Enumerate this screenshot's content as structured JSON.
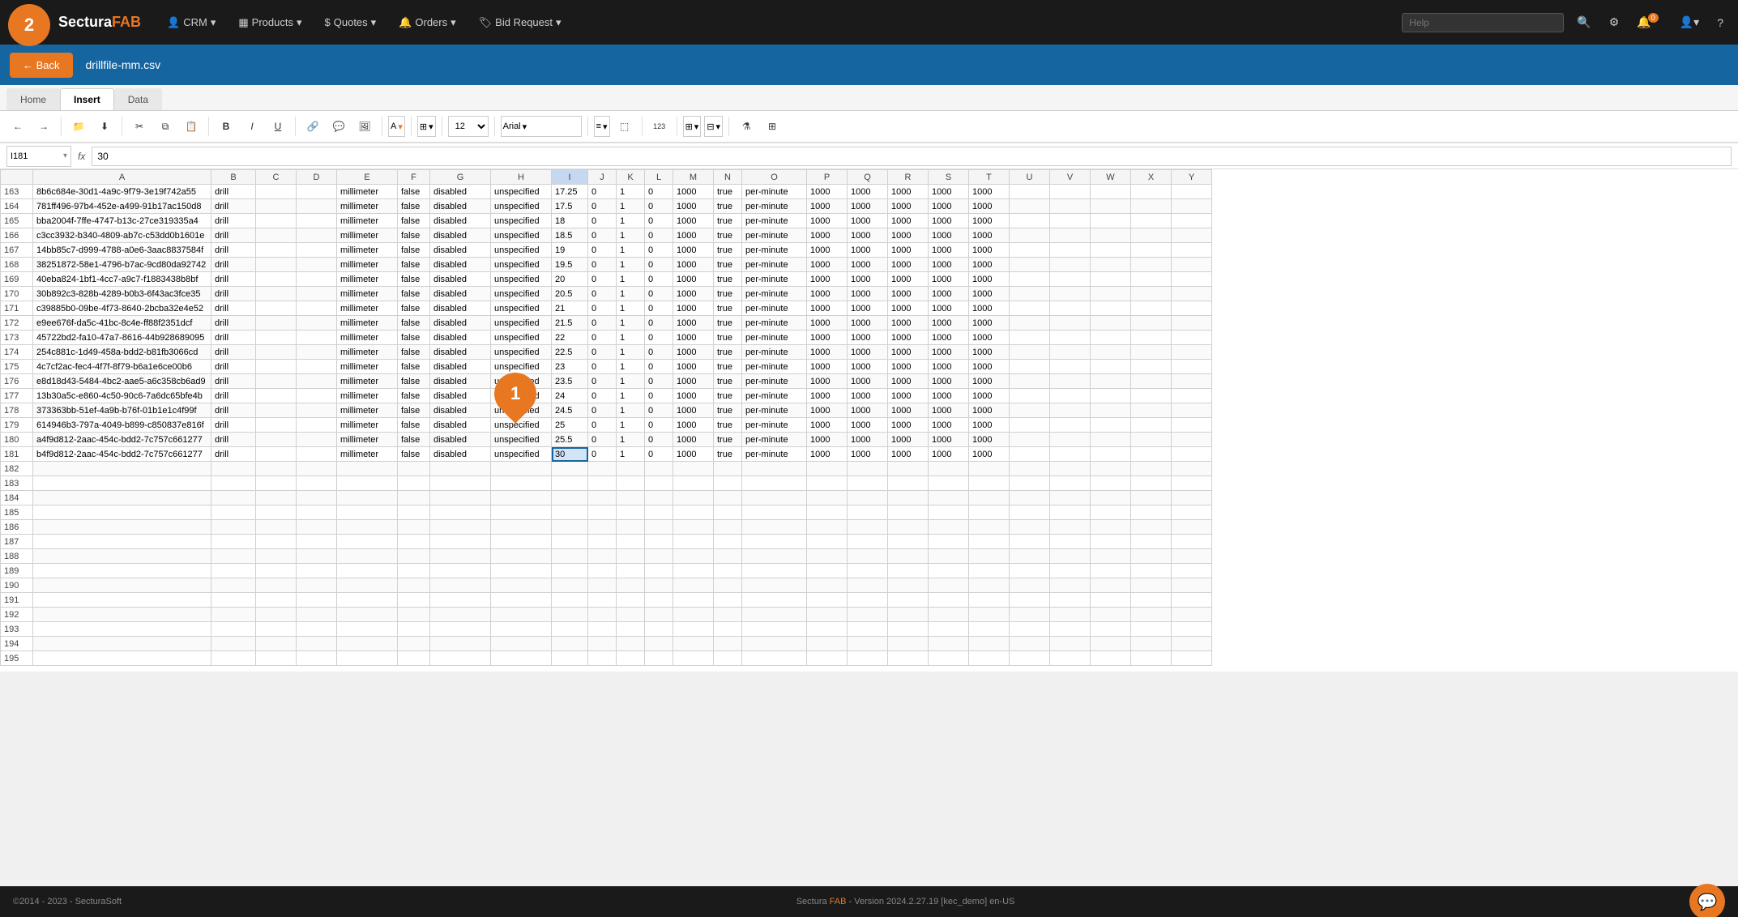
{
  "app": {
    "brand_sectura": "Sectura",
    "brand_fab": "FAB",
    "badge_count": "0"
  },
  "navbar": {
    "crm_label": "CRM",
    "products_label": "Products",
    "quotes_label": "Quotes",
    "orders_label": "Orders",
    "bid_request_label": "Bid Request",
    "help_placeholder": "Help"
  },
  "breadcrumb": {
    "back_label": "← Back",
    "file_name": "drillfile-mm.csv"
  },
  "tabs": {
    "home_label": "Home",
    "insert_label": "Insert",
    "data_label": "Data"
  },
  "formula_bar": {
    "cell_ref": "I181",
    "formula_symbol": "fx",
    "value": "30"
  },
  "columns": [
    "",
    "A",
    "B",
    "C",
    "D",
    "E",
    "F",
    "G",
    "H",
    "I",
    "J",
    "K",
    "L",
    "M",
    "N",
    "O",
    "P",
    "Q",
    "R",
    "S",
    "T",
    "U",
    "V",
    "W",
    "X",
    "Y"
  ],
  "rows": [
    {
      "num": 163,
      "A": "8b6c684e-30d1-4a9c-9f79-3e19f742a55",
      "B": "drill",
      "C": "",
      "D": "",
      "E": "millimeter",
      "F": "false",
      "G": "disabled",
      "H": "unspecified",
      "I": "17.25",
      "J": "0",
      "K": "1",
      "L": "0",
      "M": "1000",
      "N": "true",
      "O": "per-minute",
      "P": "1000",
      "Q": "1000",
      "R": "1000",
      "S": "1000",
      "T": "1000",
      "U": "",
      "V": "",
      "W": "",
      "X": "",
      "Y": ""
    },
    {
      "num": 164,
      "A": "781ff496-97b4-452e-a499-91b17ac150d8",
      "B": "drill",
      "C": "",
      "D": "",
      "E": "millimeter",
      "F": "false",
      "G": "disabled",
      "H": "unspecified",
      "I": "17.5",
      "J": "0",
      "K": "1",
      "L": "0",
      "M": "1000",
      "N": "true",
      "O": "per-minute",
      "P": "1000",
      "Q": "1000",
      "R": "1000",
      "S": "1000",
      "T": "1000",
      "U": "",
      "V": "",
      "W": "",
      "X": "",
      "Y": ""
    },
    {
      "num": 165,
      "A": "bba2004f-7ffe-4747-b13c-27ce319335a4",
      "B": "drill",
      "C": "",
      "D": "",
      "E": "millimeter",
      "F": "false",
      "G": "disabled",
      "H": "unspecified",
      "I": "18",
      "J": "0",
      "K": "1",
      "L": "0",
      "M": "1000",
      "N": "true",
      "O": "per-minute",
      "P": "1000",
      "Q": "1000",
      "R": "1000",
      "S": "1000",
      "T": "1000",
      "U": "",
      "V": "",
      "W": "",
      "X": "",
      "Y": ""
    },
    {
      "num": 166,
      "A": "c3cc3932-b340-4809-ab7c-c53dd0b1601e",
      "B": "drill",
      "C": "",
      "D": "",
      "E": "millimeter",
      "F": "false",
      "G": "disabled",
      "H": "unspecified",
      "I": "18.5",
      "J": "0",
      "K": "1",
      "L": "0",
      "M": "1000",
      "N": "true",
      "O": "per-minute",
      "P": "1000",
      "Q": "1000",
      "R": "1000",
      "S": "1000",
      "T": "1000",
      "U": "",
      "V": "",
      "W": "",
      "X": "",
      "Y": ""
    },
    {
      "num": 167,
      "A": "14bb85c7-d999-4788-a0e6-3aac8837584f",
      "B": "drill",
      "C": "",
      "D": "",
      "E": "millimeter",
      "F": "false",
      "G": "disabled",
      "H": "unspecified",
      "I": "19",
      "J": "0",
      "K": "1",
      "L": "0",
      "M": "1000",
      "N": "true",
      "O": "per-minute",
      "P": "1000",
      "Q": "1000",
      "R": "1000",
      "S": "1000",
      "T": "1000",
      "U": "",
      "V": "",
      "W": "",
      "X": "",
      "Y": ""
    },
    {
      "num": 168,
      "A": "38251872-58e1-4796-b7ac-9cd80da92742",
      "B": "drill",
      "C": "",
      "D": "",
      "E": "millimeter",
      "F": "false",
      "G": "disabled",
      "H": "unspecified",
      "I": "19.5",
      "J": "0",
      "K": "1",
      "L": "0",
      "M": "1000",
      "N": "true",
      "O": "per-minute",
      "P": "1000",
      "Q": "1000",
      "R": "1000",
      "S": "1000",
      "T": "1000",
      "U": "",
      "V": "",
      "W": "",
      "X": "",
      "Y": ""
    },
    {
      "num": 169,
      "A": "40eba824-1bf1-4cc7-a9c7-f1883438b8bf",
      "B": "drill",
      "C": "",
      "D": "",
      "E": "millimeter",
      "F": "false",
      "G": "disabled",
      "H": "unspecified",
      "I": "20",
      "J": "0",
      "K": "1",
      "L": "0",
      "M": "1000",
      "N": "true",
      "O": "per-minute",
      "P": "1000",
      "Q": "1000",
      "R": "1000",
      "S": "1000",
      "T": "1000",
      "U": "",
      "V": "",
      "W": "",
      "X": "",
      "Y": ""
    },
    {
      "num": 170,
      "A": "30b892c3-828b-4289-b0b3-6f43ac3fce35",
      "B": "drill",
      "C": "",
      "D": "",
      "E": "millimeter",
      "F": "false",
      "G": "disabled",
      "H": "unspecified",
      "I": "20.5",
      "J": "0",
      "K": "1",
      "L": "0",
      "M": "1000",
      "N": "true",
      "O": "per-minute",
      "P": "1000",
      "Q": "1000",
      "R": "1000",
      "S": "1000",
      "T": "1000",
      "U": "",
      "V": "",
      "W": "",
      "X": "",
      "Y": ""
    },
    {
      "num": 171,
      "A": "c39885b0-09be-4f73-8640-2bcba32e4e52",
      "B": "drill",
      "C": "",
      "D": "",
      "E": "millimeter",
      "F": "false",
      "G": "disabled",
      "H": "unspecified",
      "I": "21",
      "J": "0",
      "K": "1",
      "L": "0",
      "M": "1000",
      "N": "true",
      "O": "per-minute",
      "P": "1000",
      "Q": "1000",
      "R": "1000",
      "S": "1000",
      "T": "1000",
      "U": "",
      "V": "",
      "W": "",
      "X": "",
      "Y": ""
    },
    {
      "num": 172,
      "A": "e9ee676f-da5c-41bc-8c4e-ff88f2351dcf",
      "B": "drill",
      "C": "",
      "D": "",
      "E": "millimeter",
      "F": "false",
      "G": "disabled",
      "H": "unspecified",
      "I": "21.5",
      "J": "0",
      "K": "1",
      "L": "0",
      "M": "1000",
      "N": "true",
      "O": "per-minute",
      "P": "1000",
      "Q": "1000",
      "R": "1000",
      "S": "1000",
      "T": "1000",
      "U": "",
      "V": "",
      "W": "",
      "X": "",
      "Y": ""
    },
    {
      "num": 173,
      "A": "45722bd2-fa10-47a7-8616-44b928689095",
      "B": "drill",
      "C": "",
      "D": "",
      "E": "millimeter",
      "F": "false",
      "G": "disabled",
      "H": "unspecified",
      "I": "22",
      "J": "0",
      "K": "1",
      "L": "0",
      "M": "1000",
      "N": "true",
      "O": "per-minute",
      "P": "1000",
      "Q": "1000",
      "R": "1000",
      "S": "1000",
      "T": "1000",
      "U": "",
      "V": "",
      "W": "",
      "X": "",
      "Y": ""
    },
    {
      "num": 174,
      "A": "254c881c-1d49-458a-bdd2-b81fb3066cd",
      "B": "drill",
      "C": "",
      "D": "",
      "E": "millimeter",
      "F": "false",
      "G": "disabled",
      "H": "unspecified",
      "I": "22.5",
      "J": "0",
      "K": "1",
      "L": "0",
      "M": "1000",
      "N": "true",
      "O": "per-minute",
      "P": "1000",
      "Q": "1000",
      "R": "1000",
      "S": "1000",
      "T": "1000",
      "U": "",
      "V": "",
      "W": "",
      "X": "",
      "Y": ""
    },
    {
      "num": 175,
      "A": "4c7cf2ac-fec4-4f7f-8f79-b6a1e6ce00b6",
      "B": "drill",
      "C": "",
      "D": "",
      "E": "millimeter",
      "F": "false",
      "G": "disabled",
      "H": "unspecified",
      "I": "23",
      "J": "0",
      "K": "1",
      "L": "0",
      "M": "1000",
      "N": "true",
      "O": "per-minute",
      "P": "1000",
      "Q": "1000",
      "R": "1000",
      "S": "1000",
      "T": "1000",
      "U": "",
      "V": "",
      "W": "",
      "X": "",
      "Y": ""
    },
    {
      "num": 176,
      "A": "e8d18d43-5484-4bc2-aae5-a6c358cb6ad9",
      "B": "drill",
      "C": "",
      "D": "",
      "E": "millimeter",
      "F": "false",
      "G": "disabled",
      "H": "unspecified",
      "I": "23.5",
      "J": "0",
      "K": "1",
      "L": "0",
      "M": "1000",
      "N": "true",
      "O": "per-minute",
      "P": "1000",
      "Q": "1000",
      "R": "1000",
      "S": "1000",
      "T": "1000",
      "U": "",
      "V": "",
      "W": "",
      "X": "",
      "Y": ""
    },
    {
      "num": 177,
      "A": "13b30a5c-e860-4c50-90c6-7a6dc65bfe4b",
      "B": "drill",
      "C": "",
      "D": "",
      "E": "millimeter",
      "F": "false",
      "G": "disabled",
      "H": "unspecified",
      "I": "24",
      "J": "0",
      "K": "1",
      "L": "0",
      "M": "1000",
      "N": "true",
      "O": "per-minute",
      "P": "1000",
      "Q": "1000",
      "R": "1000",
      "S": "1000",
      "T": "1000",
      "U": "",
      "V": "",
      "W": "",
      "X": "",
      "Y": ""
    },
    {
      "num": 178,
      "A": "373363bb-51ef-4a9b-b76f-01b1e1c4f99f",
      "B": "drill",
      "C": "",
      "D": "",
      "E": "millimeter",
      "F": "false",
      "G": "disabled",
      "H": "unspecified",
      "I": "24.5",
      "J": "0",
      "K": "1",
      "L": "0",
      "M": "1000",
      "N": "true",
      "O": "per-minute",
      "P": "1000",
      "Q": "1000",
      "R": "1000",
      "S": "1000",
      "T": "1000",
      "U": "",
      "V": "",
      "W": "",
      "X": "",
      "Y": ""
    },
    {
      "num": 179,
      "A": "614946b3-797a-4049-b899-c850837e816f",
      "B": "drill",
      "C": "",
      "D": "",
      "E": "millimeter",
      "F": "false",
      "G": "disabled",
      "H": "unspecified",
      "I": "25",
      "J": "0",
      "K": "1",
      "L": "0",
      "M": "1000",
      "N": "true",
      "O": "per-minute",
      "P": "1000",
      "Q": "1000",
      "R": "1000",
      "S": "1000",
      "T": "1000",
      "U": "",
      "V": "",
      "W": "",
      "X": "",
      "Y": ""
    },
    {
      "num": 180,
      "A": "a4f9d812-2aac-454c-bdd2-7c757c661277",
      "B": "drill",
      "C": "",
      "D": "",
      "E": "millimeter",
      "F": "false",
      "G": "disabled",
      "H": "unspecified",
      "I": "25.5",
      "J": "0",
      "K": "1",
      "L": "0",
      "M": "1000",
      "N": "true",
      "O": "per-minute",
      "P": "1000",
      "Q": "1000",
      "R": "1000",
      "S": "1000",
      "T": "1000",
      "U": "",
      "V": "",
      "W": "",
      "X": "",
      "Y": ""
    },
    {
      "num": 181,
      "A": "b4f9d812-2aac-454c-bdd2-7c757c661277",
      "B": "drill",
      "C": "",
      "D": "",
      "E": "millimeter",
      "F": "false",
      "G": "disabled",
      "H": "unspecified",
      "I": "30",
      "J": "0",
      "K": "1",
      "L": "0",
      "M": "1000",
      "N": "true",
      "O": "per-minute",
      "P": "1000",
      "Q": "1000",
      "R": "1000",
      "S": "1000",
      "T": "1000",
      "U": "",
      "V": "",
      "W": "",
      "X": "",
      "Y": ""
    },
    {
      "num": 182,
      "A": "",
      "B": "",
      "C": "",
      "D": "",
      "E": "",
      "F": "",
      "G": "",
      "H": "",
      "I": "",
      "J": "",
      "K": "",
      "L": "",
      "M": "",
      "N": "",
      "O": "",
      "P": "",
      "Q": "",
      "R": "",
      "S": "",
      "T": "",
      "U": "",
      "V": "",
      "W": "",
      "X": "",
      "Y": ""
    },
    {
      "num": 183,
      "A": "",
      "B": "",
      "C": "",
      "D": "",
      "E": "",
      "F": "",
      "G": "",
      "H": "",
      "I": "",
      "J": "",
      "K": "",
      "L": "",
      "M": "",
      "N": "",
      "O": "",
      "P": "",
      "Q": "",
      "R": "",
      "S": "",
      "T": "",
      "U": "",
      "V": "",
      "W": "",
      "X": "",
      "Y": ""
    },
    {
      "num": 184,
      "A": "",
      "B": "",
      "C": "",
      "D": "",
      "E": "",
      "F": "",
      "G": "",
      "H": "",
      "I": "",
      "J": "",
      "K": "",
      "L": "",
      "M": "",
      "N": "",
      "O": "",
      "P": "",
      "Q": "",
      "R": "",
      "S": "",
      "T": "",
      "U": "",
      "V": "",
      "W": "",
      "X": "",
      "Y": ""
    },
    {
      "num": 185,
      "A": "",
      "B": "",
      "C": "",
      "D": "",
      "E": "",
      "F": "",
      "G": "",
      "H": "",
      "I": "",
      "J": "",
      "K": "",
      "L": "",
      "M": "",
      "N": "",
      "O": "",
      "P": "",
      "Q": "",
      "R": "",
      "S": "",
      "T": "",
      "U": "",
      "V": "",
      "W": "",
      "X": "",
      "Y": ""
    },
    {
      "num": 186,
      "A": "",
      "B": "",
      "C": "",
      "D": "",
      "E": "",
      "F": "",
      "G": "",
      "H": "",
      "I": "",
      "J": "",
      "K": "",
      "L": "",
      "M": "",
      "N": "",
      "O": "",
      "P": "",
      "Q": "",
      "R": "",
      "S": "",
      "T": "",
      "U": "",
      "V": "",
      "W": "",
      "X": "",
      "Y": ""
    },
    {
      "num": 187,
      "A": "",
      "B": "",
      "C": "",
      "D": "",
      "E": "",
      "F": "",
      "G": "",
      "H": "",
      "I": "",
      "J": "",
      "K": "",
      "L": "",
      "M": "",
      "N": "",
      "O": "",
      "P": "",
      "Q": "",
      "R": "",
      "S": "",
      "T": "",
      "U": "",
      "V": "",
      "W": "",
      "X": "",
      "Y": ""
    },
    {
      "num": 188,
      "A": "",
      "B": "",
      "C": "",
      "D": "",
      "E": "",
      "F": "",
      "G": "",
      "H": "",
      "I": "",
      "J": "",
      "K": "",
      "L": "",
      "M": "",
      "N": "",
      "O": "",
      "P": "",
      "Q": "",
      "R": "",
      "S": "",
      "T": "",
      "U": "",
      "V": "",
      "W": "",
      "X": "",
      "Y": ""
    },
    {
      "num": 189,
      "A": "",
      "B": "",
      "C": "",
      "D": "",
      "E": "",
      "F": "",
      "G": "",
      "H": "",
      "I": "",
      "J": "",
      "K": "",
      "L": "",
      "M": "",
      "N": "",
      "O": "",
      "P": "",
      "Q": "",
      "R": "",
      "S": "",
      "T": "",
      "U": "",
      "V": "",
      "W": "",
      "X": "",
      "Y": ""
    },
    {
      "num": 190,
      "A": "",
      "B": "",
      "C": "",
      "D": "",
      "E": "",
      "F": "",
      "G": "",
      "H": "",
      "I": "",
      "J": "",
      "K": "",
      "L": "",
      "M": "",
      "N": "",
      "O": "",
      "P": "",
      "Q": "",
      "R": "",
      "S": "",
      "T": "",
      "U": "",
      "V": "",
      "W": "",
      "X": "",
      "Y": ""
    },
    {
      "num": 191,
      "A": "",
      "B": "",
      "C": "",
      "D": "",
      "E": "",
      "F": "",
      "G": "",
      "H": "",
      "I": "",
      "J": "",
      "K": "",
      "L": "",
      "M": "",
      "N": "",
      "O": "",
      "P": "",
      "Q": "",
      "R": "",
      "S": "",
      "T": "",
      "U": "",
      "V": "",
      "W": "",
      "X": "",
      "Y": ""
    },
    {
      "num": 192,
      "A": "",
      "B": "",
      "C": "",
      "D": "",
      "E": "",
      "F": "",
      "G": "",
      "H": "",
      "I": "",
      "J": "",
      "K": "",
      "L": "",
      "M": "",
      "N": "",
      "O": "",
      "P": "",
      "Q": "",
      "R": "",
      "S": "",
      "T": "",
      "U": "",
      "V": "",
      "W": "",
      "X": "",
      "Y": ""
    },
    {
      "num": 193,
      "A": "",
      "B": "",
      "C": "",
      "D": "",
      "E": "",
      "F": "",
      "G": "",
      "H": "",
      "I": "",
      "J": "",
      "K": "",
      "L": "",
      "M": "",
      "N": "",
      "O": "",
      "P": "",
      "Q": "",
      "R": "",
      "S": "",
      "T": "",
      "U": "",
      "V": "",
      "W": "",
      "X": "",
      "Y": ""
    },
    {
      "num": 194,
      "A": "",
      "B": "",
      "C": "",
      "D": "",
      "E": "",
      "F": "",
      "G": "",
      "H": "",
      "I": "",
      "J": "",
      "K": "",
      "L": "",
      "M": "",
      "N": "",
      "O": "",
      "P": "",
      "Q": "",
      "R": "",
      "S": "",
      "T": "",
      "U": "",
      "V": "",
      "W": "",
      "X": "",
      "Y": ""
    },
    {
      "num": 195,
      "A": "",
      "B": "",
      "C": "",
      "D": "",
      "E": "",
      "F": "",
      "G": "",
      "H": "",
      "I": "",
      "J": "",
      "K": "",
      "L": "",
      "M": "",
      "N": "",
      "O": "",
      "P": "",
      "Q": "",
      "R": "",
      "S": "",
      "T": "",
      "U": "",
      "V": "",
      "W": "",
      "X": "",
      "Y": ""
    }
  ],
  "footer": {
    "copyright": "©2014 - 2023 - SecturaSoft",
    "version": "Sectura FAB - Version 2024.2.27.19 [kec_demo] en-US"
  },
  "annotations": {
    "badge1_num": "1",
    "badge2_num": "2"
  }
}
